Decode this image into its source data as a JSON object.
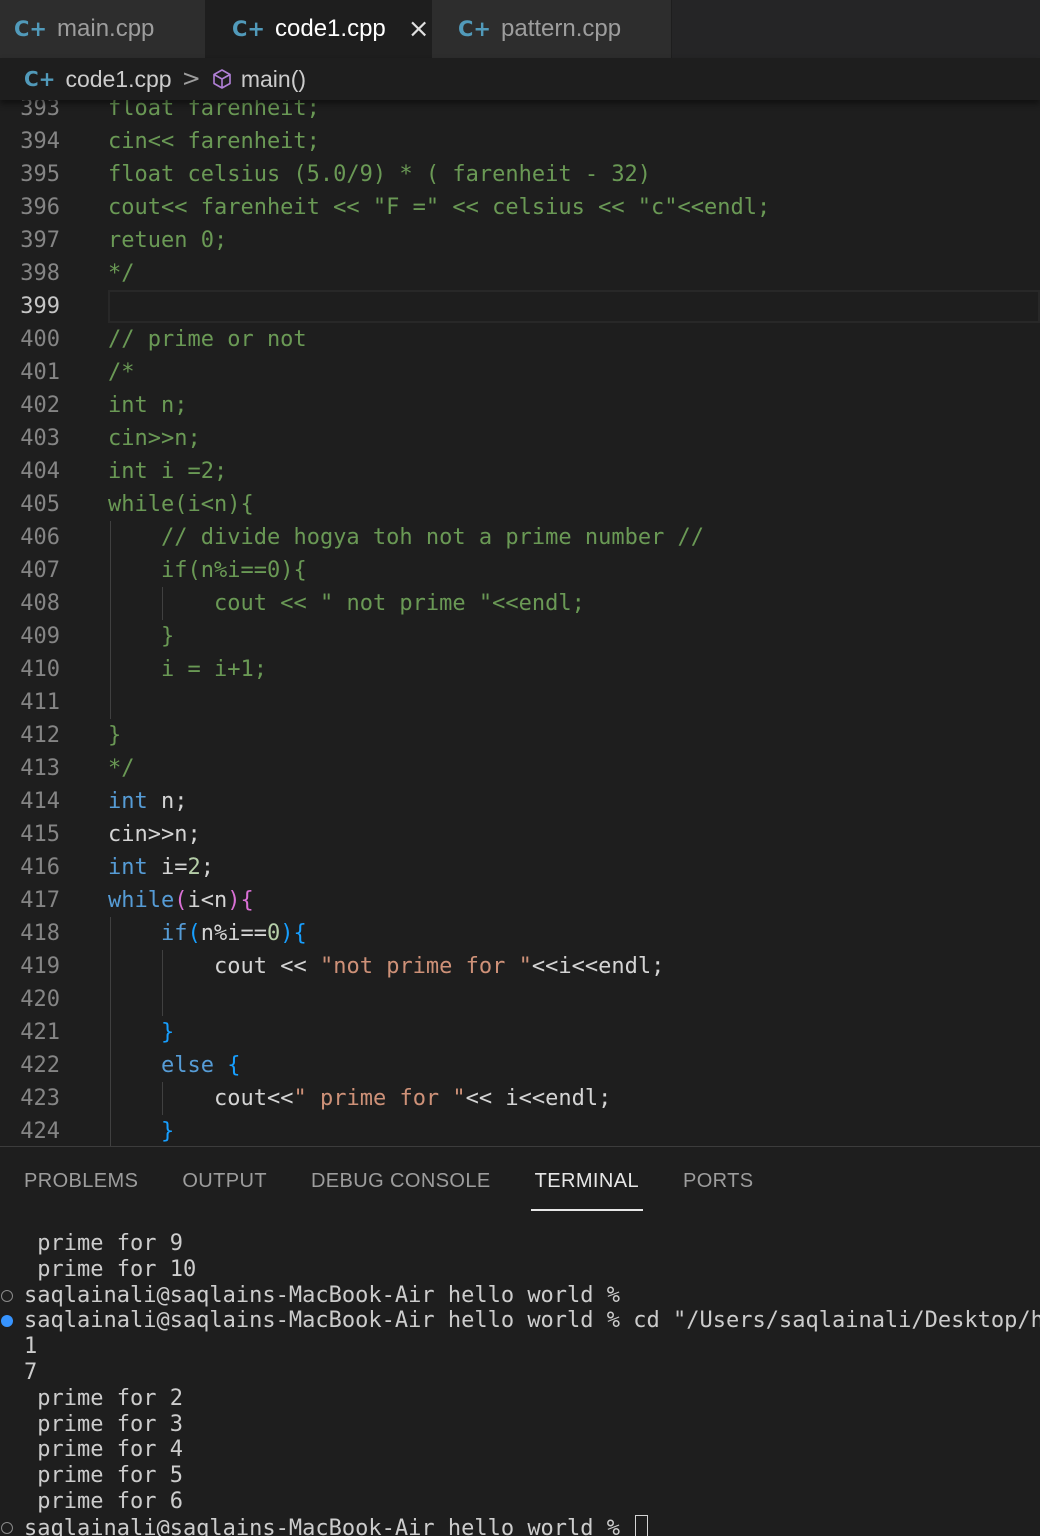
{
  "tabs": [
    {
      "label": "main.cpp",
      "icon": "cpp-file-icon",
      "active": false
    },
    {
      "label": "code1.cpp",
      "icon": "cpp-file-icon",
      "active": true,
      "close": "×"
    },
    {
      "label": "pattern.cpp",
      "icon": "cpp-file-icon",
      "active": false
    }
  ],
  "breadcrumb": {
    "file": "code1.cpp",
    "separator": ">",
    "symbol": "main()"
  },
  "code": {
    "line_numbers": [
      "393",
      "394",
      "395",
      "396",
      "397",
      "398",
      "399",
      "400",
      "401",
      "402",
      "403",
      "404",
      "405",
      "406",
      "407",
      "408",
      "409",
      "410",
      "411",
      "412",
      "413",
      "414",
      "415",
      "416",
      "417",
      "418",
      "419",
      "420",
      "421",
      "422",
      "423",
      "424"
    ],
    "current_line": "399",
    "lines": {
      "l393": "float farenheit;",
      "l394": "cin<< farenheit;",
      "l395": "float celsius (5.0/9) * ( farenheit - 32)",
      "l396": "cout<< farenheit << \"F =\" << celsius << \"c\"<<endl;",
      "l397": "retuen 0;",
      "l398": "*/",
      "l400": "// prime or not",
      "l401": "/*",
      "l402": "int n;",
      "l403": "cin>>n;",
      "l404": "int i =2;",
      "l405": "while(i<n){",
      "l406": "// divide hogya toh not a prime number //",
      "l407": "if(n%i==0){",
      "l408": "cout << \" not prime \"<<endl;",
      "l409": "}",
      "l410": "i = i+1;",
      "l412": "}",
      "l413": "*/",
      "l414_kw": "int",
      "l414_rest": " n;",
      "l415": "cin>>n;",
      "l416_kw": "int",
      "l416_a": " i=",
      "l416_num": "2",
      "l416_b": ";",
      "l417_kw": "while",
      "l417_open": "(",
      "l417_mid": "i<n",
      "l417_close": ")",
      "l417_brace": "{",
      "l418_kw": "if",
      "l418_open": "(",
      "l418_mid": "n%i==",
      "l418_num": "0",
      "l418_close": ")",
      "l418_brace": "{",
      "l419_a": "cout << ",
      "l419_str": "\"not prime for \"",
      "l419_b": "<<i<<endl;",
      "l421_brace": "}",
      "l422_kw": "else",
      "l422_brace": " {",
      "l423_a": "cout<<",
      "l423_str": "\" prime for \"",
      "l423_b": "<< i<<endl;",
      "l424_brace": "}"
    }
  },
  "panel": {
    "tabs": [
      "PROBLEMS",
      "OUTPUT",
      "DEBUG CONSOLE",
      "TERMINAL",
      "PORTS"
    ],
    "active_tab": "TERMINAL"
  },
  "terminal": {
    "lines": [
      {
        "text": " prime for 9",
        "marker": "none"
      },
      {
        "text": " prime for 10",
        "marker": "none"
      },
      {
        "text": "saqlainali@saqlains-MacBook-Air hello world %",
        "marker": "hollow"
      },
      {
        "text": "saqlainali@saqlains-MacBook-Air hello world % cd \"/Users/saqlainali/Desktop/hel",
        "marker": "filled"
      },
      {
        "text": "1",
        "marker": "none"
      },
      {
        "text": "7",
        "marker": "none"
      },
      {
        "text": " prime for 2",
        "marker": "none"
      },
      {
        "text": " prime for 3",
        "marker": "none"
      },
      {
        "text": " prime for 4",
        "marker": "none"
      },
      {
        "text": " prime for 5",
        "marker": "none"
      },
      {
        "text": " prime for 6",
        "marker": "none"
      },
      {
        "text": "saqlainali@saqlains-MacBook-Air hello world % ",
        "marker": "hollow",
        "cursor": true
      }
    ]
  },
  "colors": {
    "editor_bg": "#1e1e1e",
    "comment": "#6a9955",
    "keyword": "#569cd6",
    "string": "#ce9178",
    "number": "#b5cea8",
    "bracket_level1": "#da70d6",
    "bracket_level2": "#179fff",
    "cpp_icon": "#519aba",
    "terminal_marker_active": "#3794ff"
  }
}
